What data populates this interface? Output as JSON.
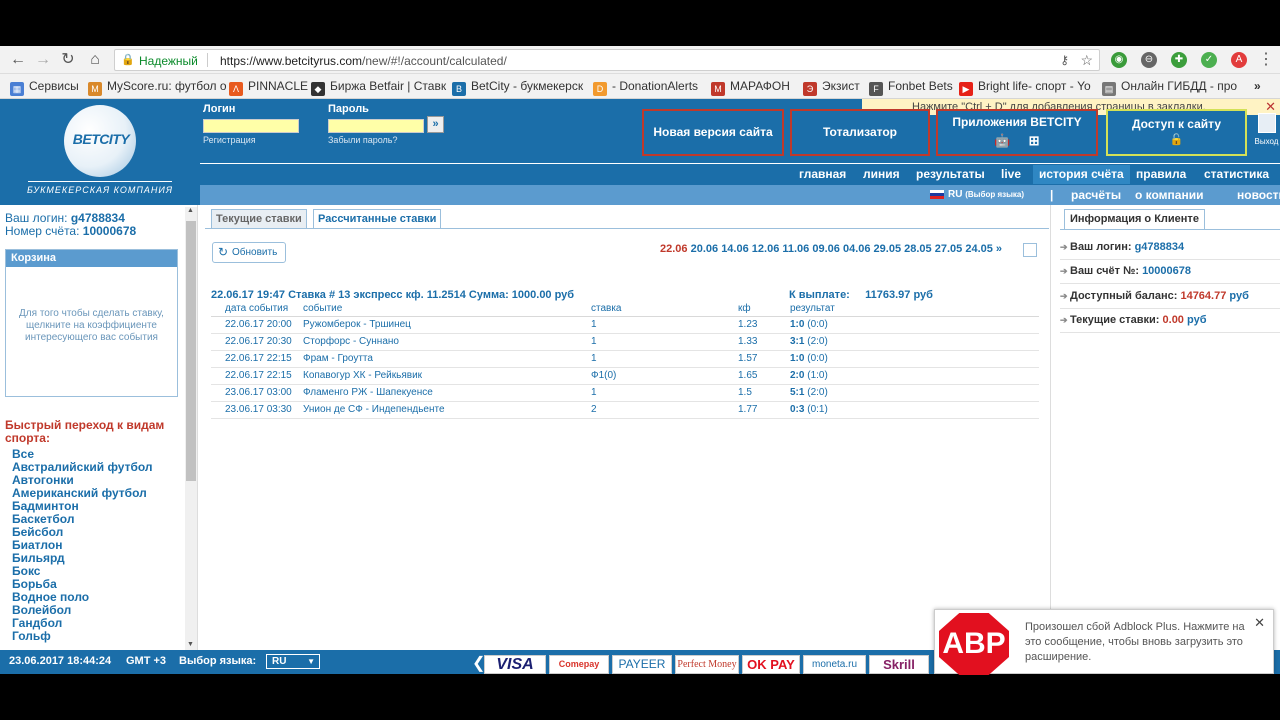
{
  "browser": {
    "secure_label": "Надежный",
    "url_base": "https://www.betcityrus.com",
    "url_path": "/new/#!/account/calculated/",
    "bookmarks": [
      "Сервисы",
      "MyScore.ru: футбол о",
      "PINNACLE",
      "Биржа Betfair | Ставк",
      "BetCity - букмекерск",
      "- DonationAlerts",
      "МАРАФОН",
      "Экзист",
      "Fonbet Bets",
      "Bright life- спорт - Yo",
      "Онлайн ГИБДД - про"
    ],
    "more": "»"
  },
  "header": {
    "logo_text": "BETCITY",
    "logo_tagline": "БУКМЕКЕРСКАЯ КОМПАНИЯ",
    "login_label": "Логин",
    "password_label": "Пароль",
    "register_link": "Регистрация",
    "forgot_link": "Забыли пароль?",
    "go": "»",
    "bookmark_notice": "Нажмите \"Ctrl + D\" для добавления страницы в закладки.",
    "btn_new_site": "Новая версия сайта",
    "btn_totalizator": "Тотализатор",
    "btn_apps": "Приложения BETCITY",
    "btn_access": "Доступ к сайту",
    "exit": "Выход",
    "menu1": [
      "главная",
      "линия",
      "результаты",
      "live",
      "история счёта",
      "правила",
      "статистика"
    ],
    "menu1_active": "история счёта",
    "lang_current": "RU",
    "lang_select": "(Выбор языка)",
    "menu2": [
      "расчёты",
      "о компании",
      "новости"
    ]
  },
  "left": {
    "login_prefix": "Ваш логин:",
    "login": "g4788834",
    "account_prefix": "Номер счёта:",
    "account": "10000678",
    "cart_title": "Корзина",
    "cart_text": "Для того чтобы сделать ставку, щелкните на коэффициенте интересующего вас события",
    "quick_title": "Быстрый переход к видам спорта:",
    "sports": [
      "Все",
      "Австралийский футбол",
      "Автогонки",
      "Американский футбол",
      "Бадминтон",
      "Баскетбол",
      "Бейсбол",
      "Биатлон",
      "Бильярд",
      "Бокс",
      "Борьба",
      "Водное поло",
      "Волейбол",
      "Гандбол",
      "Гольф"
    ]
  },
  "center": {
    "tab_current": "Текущие ставки",
    "tab_calculated": "Рассчитанные ставки",
    "refresh": "Обновить",
    "dates": [
      "22.06",
      "20.06",
      "14.06",
      "12.06",
      "11.06",
      "09.06",
      "04.06",
      "29.05",
      "28.05",
      "27.05",
      "24.05"
    ],
    "dates_more": "»",
    "bet_header": "22.06.17 19:47  Ставка # 13  экспресс  кф. 11.2514  Сумма: 1000.00 руб",
    "payout_label": "К выплате:",
    "payout_value": "11763.97 руб",
    "columns": [
      "дата события",
      "событие",
      "ставка",
      "кф",
      "результат"
    ],
    "rows": [
      {
        "date": "22.06.17 20:00",
        "event": "Ружомберок - Тршинец",
        "bet": "1",
        "kf": "1.23",
        "score": "1:0",
        "half": "(0:0)"
      },
      {
        "date": "22.06.17 20:30",
        "event": "Сторфорс - Суннано",
        "bet": "1",
        "kf": "1.33",
        "score": "3:1",
        "half": "(2:0)"
      },
      {
        "date": "22.06.17 22:15",
        "event": "Фрам - Гроутта",
        "bet": "1",
        "kf": "1.57",
        "score": "1:0",
        "half": "(0:0)"
      },
      {
        "date": "22.06.17 22:15",
        "event": "Копавогур ХК - Рейкьявик",
        "bet": "Ф1(0)",
        "kf": "1.65",
        "score": "2:0",
        "half": "(1:0)"
      },
      {
        "date": "23.06.17 03:00",
        "event": "Фламенго РЖ - Шапекуенсе",
        "bet": "1",
        "kf": "1.5",
        "score": "5:1",
        "half": "(2:0)"
      },
      {
        "date": "23.06.17 03:30",
        "event": "Унион де СФ - Индепендьенте",
        "bet": "2",
        "kf": "1.77",
        "score": "0:3",
        "half": "(0:1)"
      }
    ]
  },
  "right": {
    "tab": "Информация о Клиенте",
    "login_label": "Ваш логин:",
    "login": "g4788834",
    "account_label": "Ваш счёт №:",
    "account": "10000678",
    "balance_label": "Доступный баланс:",
    "balance": "14764.77",
    "currency": "руб",
    "current_label": "Текущие ставки:",
    "current": "0.00"
  },
  "footer": {
    "datetime": "23.06.2017 18:44:24",
    "gmt": "GMT +3",
    "lang_label": "Выбор языка:",
    "lang": "RU",
    "payments": [
      "VISA",
      "Comepay",
      "PAYEER",
      "Perfect Money",
      "OK PAY",
      "moneta.ru",
      "Skrill"
    ]
  },
  "abp": {
    "logo": "ABP",
    "message": "Произошел сбой Adblock Plus. Нажмите на это сообщение, чтобы вновь загрузить это расширение."
  },
  "colors": {
    "brand_blue": "#1b6ea9",
    "accent_red": "#c0392b",
    "menu_light": "#5b9bcf"
  }
}
